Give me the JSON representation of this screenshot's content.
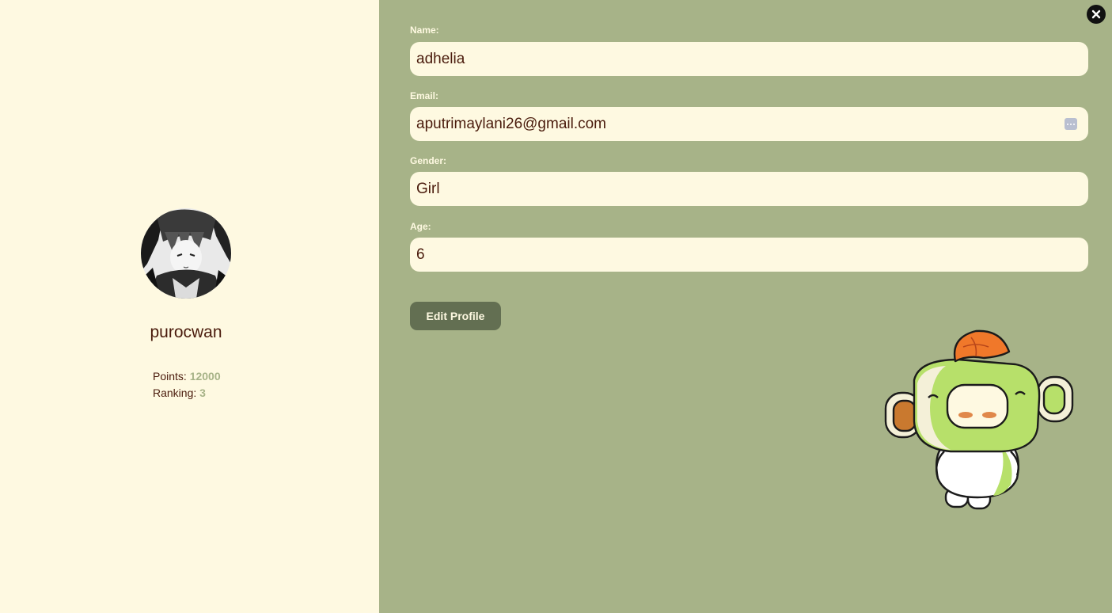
{
  "profile": {
    "avatar_icon": "anime-character-avatar",
    "username": "purocwan",
    "points_label": "Points:",
    "points_value": "12000",
    "ranking_label": "Ranking:",
    "ranking_value": "3"
  },
  "form": {
    "name": {
      "label": "Name:",
      "value": "adhelia"
    },
    "email": {
      "label": "Email:",
      "value": "aputrimaylani26@gmail.com"
    },
    "gender": {
      "label": "Gender:",
      "value": "Girl"
    },
    "age": {
      "label": "Age:",
      "value": "6"
    },
    "submit_label": "Edit Profile"
  },
  "icons": {
    "close": "close-icon",
    "autofill": "password-manager-icon",
    "mascot": "monkey-mascot-illustration"
  },
  "colors": {
    "left_bg": "#fef9e1",
    "right_bg": "#a7b388",
    "text_dark": "#4a1b0c",
    "button_bg": "#636f52",
    "accent_value": "#a7b388"
  }
}
